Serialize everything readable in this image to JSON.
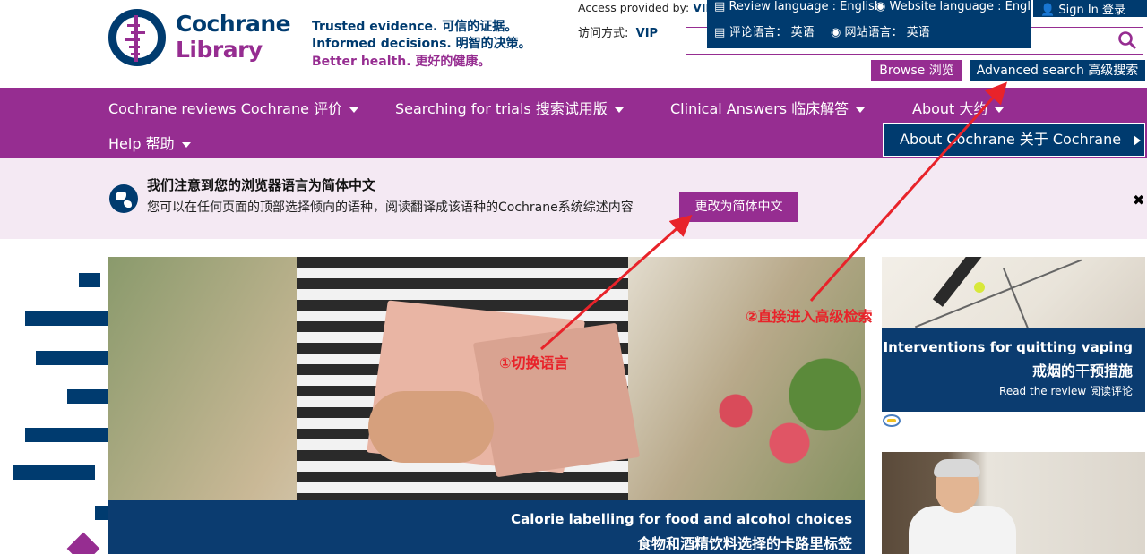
{
  "logo": {
    "line1": "Cochrane",
    "line2": "Library"
  },
  "tagline": {
    "line1": "Trusted evidence. 可信的证据。",
    "line2": "Informed decisions. 明智的决策。",
    "line3": "Better health. 更好的健康。"
  },
  "access": {
    "label": "Access provided by:",
    "value": "VIP"
  },
  "visit": {
    "label": "访问方式:",
    "value": "VIP"
  },
  "lang": {
    "review_en": "Review language : English",
    "website_en": "Website language : English",
    "review_zh": "评论语言： 英语",
    "website_zh": "网站语言： 英语"
  },
  "signin": "Sign In  登录",
  "buttons": {
    "browse": "Browse  浏览",
    "advanced": "Advanced search  高级搜索"
  },
  "nav": {
    "reviews": "Cochrane reviews  Cochrane 评价",
    "trials": "Searching for trials  搜索试用版",
    "clinical": "Clinical Answers  临床解答",
    "about": "About  大约",
    "help": "Help  帮助",
    "about_cochrane": "About Cochrane  关于 Cochrane"
  },
  "notice": {
    "title": "我们注意到您的浏览器语言为简体中文",
    "body": "您可以在任何页面的顶部选择倾向的语种，阅读翻译成该语种的Cochrane系统综述内容",
    "button": "更改为简体中文",
    "close": "✖"
  },
  "hero": {
    "caption_en": "Calorie labelling for food and alcohol choices",
    "caption_zh": "食物和酒精饮料选择的卡路里标签"
  },
  "side": {
    "title_en": "Interventions for quitting vaping",
    "title_zh": "戒烟的干预措施",
    "read": "Read the review  阅读评论"
  },
  "annotations": {
    "a1": "①切换语言",
    "a2": "②直接进入高级检索"
  },
  "colors": {
    "navy": "#003b6f",
    "purple": "#962d91",
    "annotation_red": "#e8232a"
  },
  "icons": [
    "document-icon",
    "globe-icon",
    "user-icon",
    "search-icon",
    "caret-down-icon",
    "caret-right-icon",
    "close-icon"
  ]
}
